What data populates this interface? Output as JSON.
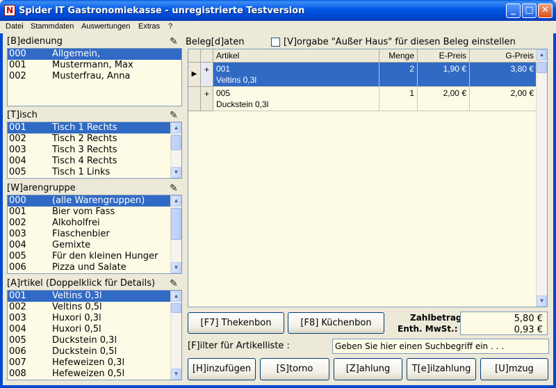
{
  "window": {
    "title": "Spider IT Gastronomiekasse - unregistrierte Testversion"
  },
  "menu": [
    "Datei",
    "Stammdaten",
    "Auswertungen",
    "Extras",
    "?"
  ],
  "bedienung": {
    "label": "[B]edienung",
    "items": [
      {
        "id": "000",
        "name": "Allgemein,"
      },
      {
        "id": "001",
        "name": "Mustermann, Max"
      },
      {
        "id": "002",
        "name": "Musterfrau, Anna"
      }
    ]
  },
  "tisch": {
    "label": "[T]isch",
    "items": [
      {
        "id": "001",
        "name": "Tisch 1 Rechts"
      },
      {
        "id": "002",
        "name": "Tisch 2 Rechts"
      },
      {
        "id": "003",
        "name": "Tisch 3 Rechts"
      },
      {
        "id": "004",
        "name": "Tisch 4 Rechts"
      },
      {
        "id": "005",
        "name": "Tisch 1 Links"
      }
    ]
  },
  "warengruppe": {
    "label": "[W]arengruppe",
    "items": [
      {
        "id": "000",
        "name": "(alle Warengruppen)"
      },
      {
        "id": "001",
        "name": "Bier vom Fass"
      },
      {
        "id": "002",
        "name": "Alkoholfrei"
      },
      {
        "id": "003",
        "name": "Flaschenbier"
      },
      {
        "id": "004",
        "name": "Gemixte"
      },
      {
        "id": "005",
        "name": "Für den kleinen Hunger"
      },
      {
        "id": "006",
        "name": "Pizza und Salate"
      }
    ]
  },
  "artikel": {
    "label": "[A]rtikel (Doppelklick für Details)",
    "items": [
      {
        "id": "001",
        "name": "Veltins 0,3l"
      },
      {
        "id": "002",
        "name": "Veltins 0,5l"
      },
      {
        "id": "003",
        "name": "Huxori 0,3l"
      },
      {
        "id": "004",
        "name": "Huxori 0,5l"
      },
      {
        "id": "005",
        "name": "Duckstein 0,3l"
      },
      {
        "id": "006",
        "name": "Duckstein 0,5l"
      },
      {
        "id": "007",
        "name": "Hefeweizen 0,3l"
      },
      {
        "id": "008",
        "name": "Hefeweizen 0,5l"
      }
    ]
  },
  "beleg": {
    "label": "Beleg[d]aten",
    "ausser_haus_label": "[V]orgabe \"Außer Haus\" für diesen Beleg einstellen",
    "columns": {
      "artikel": "Artikel",
      "menge": "Menge",
      "epreis": "E-Preis",
      "gpreis": "G-Preis"
    },
    "rows": [
      {
        "marker": "▶",
        "expand": "+",
        "nr": "001",
        "name": "Veltins 0,3l",
        "menge": "2",
        "epreis": "1,90 €",
        "gpreis": "3,80 €"
      },
      {
        "marker": "",
        "expand": "+",
        "nr": "005",
        "name": "Duckstein 0,3l",
        "menge": "1",
        "epreis": "2,00 €",
        "gpreis": "2,00 €"
      }
    ]
  },
  "buttons": {
    "thekenbon": "[F7]  Thekenbon",
    "kuechenbon": "[F8]  Küchenbon",
    "hinzufuegen": "[H]inzufügen",
    "storno": "[S]torno",
    "zahlung": "[Z]ahlung",
    "teilzahlung": "T[e]ilzahlung",
    "umzug": "[U]mzug"
  },
  "totals": {
    "zahlbetrag_label": "Zahlbetrag :",
    "zahlbetrag": "5,80 €",
    "mwst_label": "Enth. MwSt.:",
    "mwst": "0,93 €"
  },
  "filter": {
    "label": "[F]ilter für Artikelliste :",
    "placeholder": "Geben Sie hier einen Suchbegriff ein . . ."
  },
  "colors": {
    "selection": "#316ac5",
    "list_bg": "#fdfbe6",
    "window_bg": "#ece9d8"
  }
}
